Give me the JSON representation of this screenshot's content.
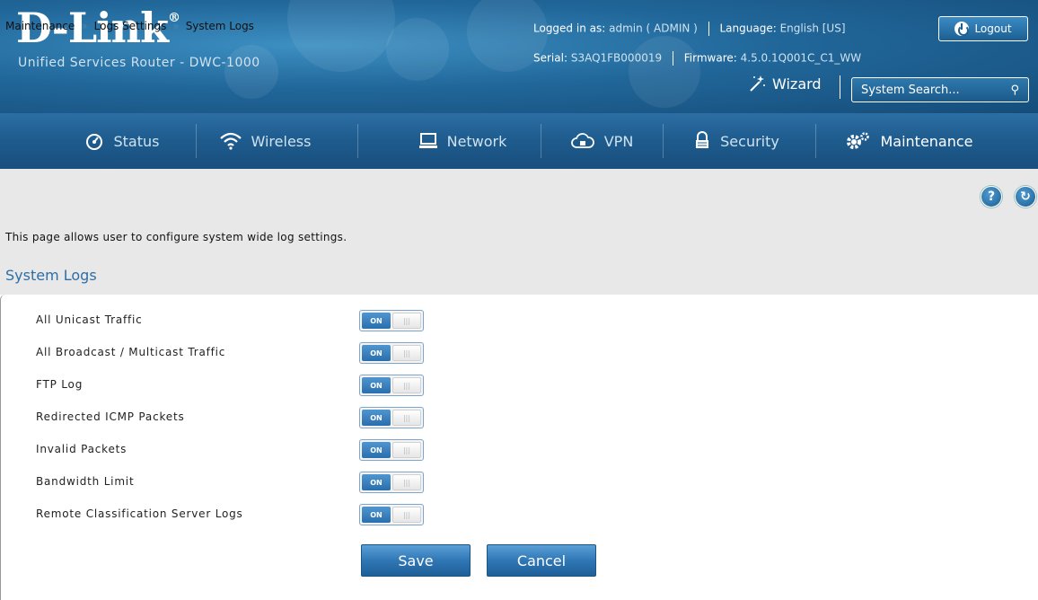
{
  "brand": {
    "logo": "D-Link",
    "registered": "®",
    "subtitle": "Unified Services Router - DWC-1000"
  },
  "header": {
    "logged_in_label": "Logged in as:",
    "logged_in_value": "admin ( ADMIN )",
    "language_label": "Language:",
    "language_value": "English [US]",
    "serial_label": "Serial:",
    "serial_value": "S3AQ1FB000019",
    "firmware_label": "Firmware:",
    "firmware_value": "4.5.0.1Q001C_C1_WW",
    "logout_label": "Logout",
    "wizard_label": "Wizard",
    "search_placeholder": "System Search..."
  },
  "nav": {
    "items": [
      {
        "label": "Status",
        "icon": "status-icon"
      },
      {
        "label": "Wireless",
        "icon": "wifi-icon"
      },
      {
        "label": "Network",
        "icon": "network-icon"
      },
      {
        "label": "VPN",
        "icon": "vpn-icon"
      },
      {
        "label": "Security",
        "icon": "lock-icon"
      },
      {
        "label": "Maintenance",
        "icon": "gears-icon",
        "active": true
      }
    ]
  },
  "breadcrumb": {
    "items": [
      "Maintenance",
      "Logs Settings",
      "System Logs"
    ],
    "separator": "»"
  },
  "page": {
    "description": "This page allows user to configure system wide log settings.",
    "section_title": "System Logs"
  },
  "settings": [
    {
      "label": "All Unicast Traffic",
      "state": "ON"
    },
    {
      "label": "All Broadcast / Multicast Traffic",
      "state": "ON"
    },
    {
      "label": "FTP Log",
      "state": "ON"
    },
    {
      "label": "Redirected ICMP Packets",
      "state": "ON"
    },
    {
      "label": "Invalid Packets",
      "state": "ON"
    },
    {
      "label": "Bandwidth Limit",
      "state": "ON"
    },
    {
      "label": "Remote Classification Server Logs",
      "state": "ON"
    }
  ],
  "actions": {
    "save_label": "Save",
    "cancel_label": "Cancel"
  },
  "colors": {
    "header_blue": "#21679a",
    "accent": "#2e6ea6",
    "toggle_on": "#2a6fae"
  }
}
